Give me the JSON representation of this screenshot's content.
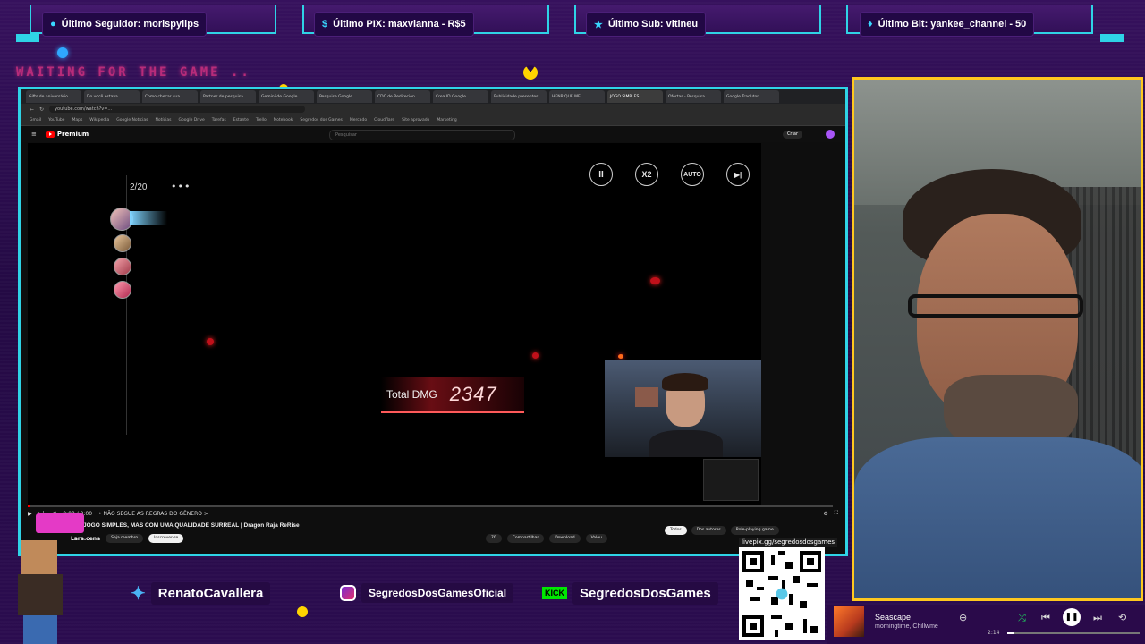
{
  "alerts": [
    {
      "icon": "user-icon",
      "text": "Último Seguidor: morispylips"
    },
    {
      "icon": "dollar-icon",
      "text": "Último PIX: maxvianna - R$5"
    },
    {
      "icon": "star-icon",
      "text": "Último Sub: vitineu"
    },
    {
      "icon": "diamond-icon",
      "text": "Último Bit: yankee_channel - 50"
    }
  ],
  "waiting_text": "WAITING FOR THE GAME ..",
  "browser": {
    "tabs": [
      "Gifts de aniversário",
      "Do você estava...",
      "Como checar sua",
      "Partner de pesquisa",
      "Gemini de Google",
      "Pesquisa Google",
      "CDC de Redirecion",
      "Crea ID Google",
      "Publicidade presentes",
      "HENRIQUE ME",
      "JOGO SIMPLES",
      "Ofertas - Pesquisa",
      "Google Tradutor"
    ],
    "url": "youtube.com/watch?v=...",
    "bookmarks": [
      "Gmail",
      "YouTube",
      "Maps",
      "Wikipedia",
      "Google Notícias",
      "Notícias",
      "Google Drive",
      "Tarefas",
      "Estante",
      "Trello",
      "Notebook",
      "Segredos dos Games",
      "Mercado",
      "Cloudflare",
      "Site aprovado",
      "Marketing"
    ]
  },
  "youtube": {
    "logo": "Premium",
    "search_placeholder": "Pesquisar",
    "create": "Criar",
    "video_title": "JOGO SIMPLES, MAS COM UMA QUALIDADE SURREAL | Dragon Raja ReRise",
    "chapter": "• NÃO SEGUE AS REGRAS DO GÊNERO >",
    "time": "0:00 / 0:00",
    "channel": "Lara.cena",
    "join": "Seja membro",
    "subscribe": "Inscrever-se",
    "actions": [
      "70",
      "Compartilhar",
      "Download",
      "Valeu"
    ],
    "filters": [
      "Todos",
      "Dos autores",
      "Role-playing game"
    ]
  },
  "game": {
    "controls": [
      "II",
      "X2",
      "AUTO",
      "▶|"
    ],
    "turn": "2/20",
    "dots": "•••",
    "total_label": "Total DMG",
    "total_value": "2347"
  },
  "socials": [
    {
      "icon": "twitter-icon",
      "text": "RenatoCavallera"
    },
    {
      "icon": "instagram-icon",
      "text": "SegredosDosGamesOficial"
    },
    {
      "icon": "kick-icon",
      "badge": "KICK",
      "text": "SegredosDosGames"
    }
  ],
  "qr_label": "livepix.gg/segredosdosgames",
  "spotify": {
    "title": "Seascape",
    "artist": "morningtime, Chillwme",
    "time": "2:14",
    "progress": 0.05
  }
}
